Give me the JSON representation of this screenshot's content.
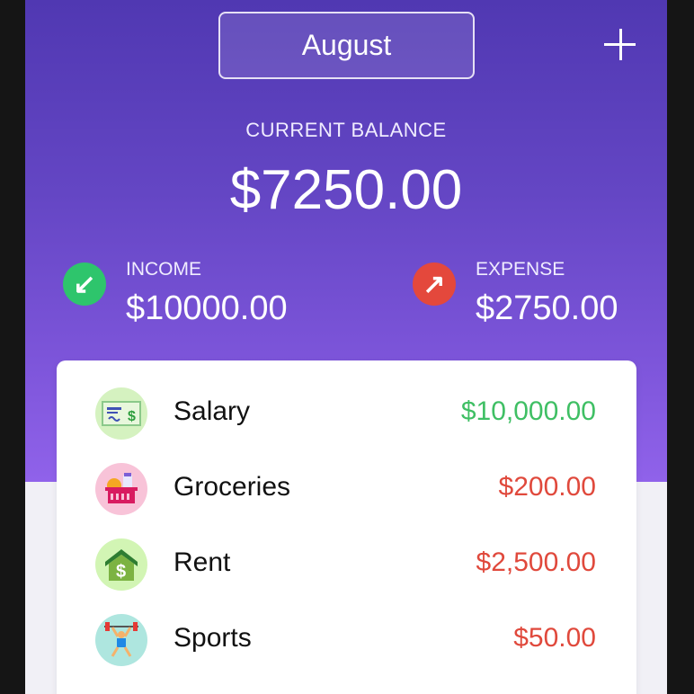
{
  "header": {
    "month": "August",
    "add_icon": "plus-icon"
  },
  "balance": {
    "label": "CURRENT BALANCE",
    "value": "$7250.00"
  },
  "income": {
    "label": "INCOME",
    "value": "$10000.00",
    "icon": "arrow-down-left-icon",
    "color": "#2ec56c"
  },
  "expense": {
    "label": "EXPENSE",
    "value": "$2750.00",
    "icon": "arrow-up-right-icon",
    "color": "#e4483c"
  },
  "transactions": [
    {
      "name": "Salary",
      "amount": "$10,000.00",
      "type": "income",
      "color": "#3fbf64",
      "icon": "check-cash-icon",
      "bg": "#d5f2c0"
    },
    {
      "name": "Groceries",
      "amount": "$200.00",
      "type": "expense",
      "color": "#e0493c",
      "icon": "grocery-basket-icon",
      "bg": "#f8c3d8"
    },
    {
      "name": "Rent",
      "amount": "$2,500.00",
      "type": "expense",
      "color": "#e0493c",
      "icon": "house-dollar-icon",
      "bg": "#d2f5b4"
    },
    {
      "name": "Sports",
      "amount": "$50.00",
      "type": "expense",
      "color": "#e0493c",
      "icon": "weightlifter-icon",
      "bg": "#aee6df"
    }
  ]
}
